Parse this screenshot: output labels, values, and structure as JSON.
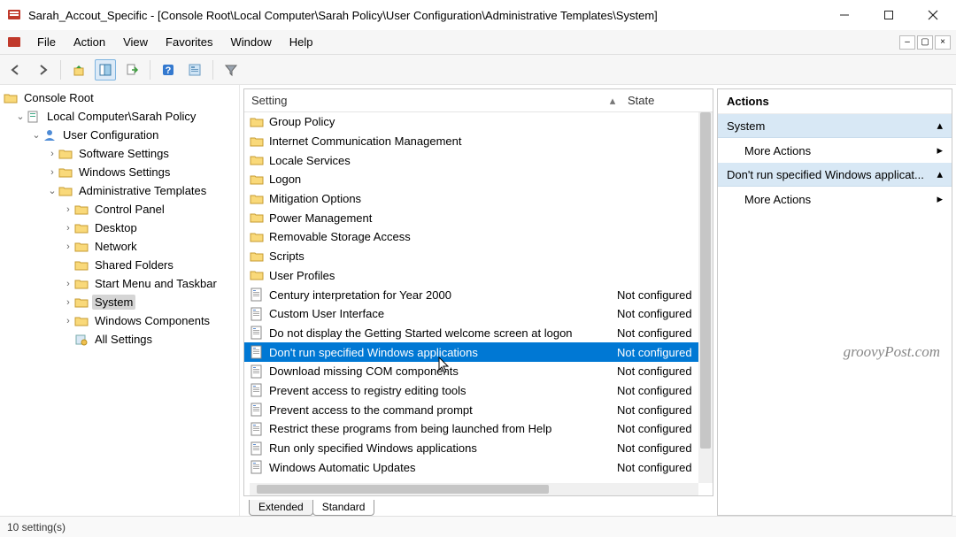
{
  "window": {
    "title": "Sarah_Accout_Specific - [Console Root\\Local Computer\\Sarah Policy\\User Configuration\\Administrative Templates\\System]"
  },
  "menu": {
    "file": "File",
    "action": "Action",
    "view": "View",
    "favorites": "Favorites",
    "window": "Window",
    "help": "Help"
  },
  "tree": {
    "root": "Console Root",
    "policy": "Local Computer\\Sarah Policy",
    "userconf": "User Configuration",
    "sw": "Software Settings",
    "win": "Windows Settings",
    "admin": "Administrative Templates",
    "cp": "Control Panel",
    "desktop": "Desktop",
    "network": "Network",
    "shared": "Shared Folders",
    "start": "Start Menu and Taskbar",
    "system": "System",
    "wincomp": "Windows Components",
    "allsettings": "All Settings"
  },
  "columns": {
    "setting": "Setting",
    "state": "State"
  },
  "rows": [
    {
      "type": "folder",
      "name": "Group Policy",
      "state": ""
    },
    {
      "type": "folder",
      "name": "Internet Communication Management",
      "state": ""
    },
    {
      "type": "folder",
      "name": "Locale Services",
      "state": ""
    },
    {
      "type": "folder",
      "name": "Logon",
      "state": ""
    },
    {
      "type": "folder",
      "name": "Mitigation Options",
      "state": ""
    },
    {
      "type": "folder",
      "name": "Power Management",
      "state": ""
    },
    {
      "type": "folder",
      "name": "Removable Storage Access",
      "state": ""
    },
    {
      "type": "folder",
      "name": "Scripts",
      "state": ""
    },
    {
      "type": "folder",
      "name": "User Profiles",
      "state": ""
    },
    {
      "type": "setting",
      "name": "Century interpretation for Year 2000",
      "state": "Not configured"
    },
    {
      "type": "setting",
      "name": "Custom User Interface",
      "state": "Not configured"
    },
    {
      "type": "setting",
      "name": "Do not display the Getting Started welcome screen at logon",
      "state": "Not configured"
    },
    {
      "type": "setting",
      "name": "Don't run specified Windows applications",
      "state": "Not configured",
      "selected": true
    },
    {
      "type": "setting",
      "name": "Download missing COM components",
      "state": "Not configured"
    },
    {
      "type": "setting",
      "name": "Prevent access to registry editing tools",
      "state": "Not configured"
    },
    {
      "type": "setting",
      "name": "Prevent access to the command prompt",
      "state": "Not configured"
    },
    {
      "type": "setting",
      "name": "Restrict these programs from being launched from Help",
      "state": "Not configured"
    },
    {
      "type": "setting",
      "name": "Run only specified Windows applications",
      "state": "Not configured"
    },
    {
      "type": "setting",
      "name": "Windows Automatic Updates",
      "state": "Not configured"
    }
  ],
  "tabs": {
    "extended": "Extended",
    "standard": "Standard"
  },
  "actions": {
    "title": "Actions",
    "section1": "System",
    "more1": "More Actions",
    "section2": "Don't run specified Windows applicat...",
    "more2": "More Actions"
  },
  "status": "10 setting(s)",
  "watermark": "groovyPost.com"
}
